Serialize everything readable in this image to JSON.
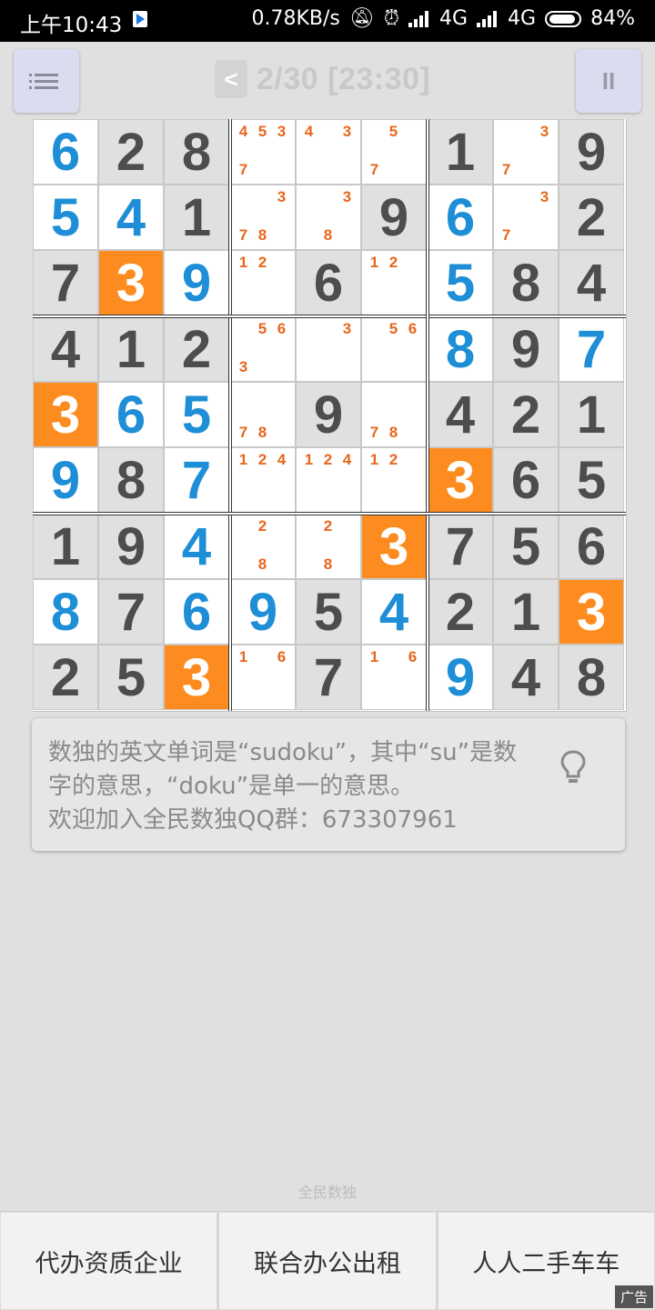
{
  "status_bar": {
    "time": "上午10:43",
    "network_speed": "0.78KB/s",
    "network_1": "4G",
    "network_2": "4G",
    "battery": "84%",
    "icons": [
      "play-store-icon",
      "mute-icon",
      "alarm-icon",
      "signal-icon",
      "hd-icon",
      "signal-icon",
      "battery-icon"
    ]
  },
  "header": {
    "back_label": "<",
    "title": "2/30 [23:30]",
    "menu_icon": "list-icon",
    "pause_label": "II"
  },
  "colors": {
    "given": "#4d4d4d",
    "user": "#1e8ed6",
    "highlight": "#fd8c20",
    "note": "#e8671b"
  },
  "board": {
    "rows": [
      [
        {
          "v": "6",
          "t": "user"
        },
        {
          "v": "2",
          "t": "given"
        },
        {
          "v": "8",
          "t": "given"
        },
        {
          "n": [
            "4",
            "5",
            "3",
            "7",
            "",
            ""
          ],
          "t": "notes"
        },
        {
          "n": [
            "4",
            "",
            "3",
            "",
            "",
            ""
          ],
          "t": "notes"
        },
        {
          "n": [
            "",
            "5",
            "",
            "7",
            "",
            ""
          ],
          "t": "notes"
        },
        {
          "v": "1",
          "t": "given"
        },
        {
          "n": [
            "",
            "",
            "3",
            "7",
            "",
            ""
          ],
          "t": "notes"
        },
        {
          "v": "9",
          "t": "given"
        }
      ],
      [
        {
          "v": "5",
          "t": "user"
        },
        {
          "v": "4",
          "t": "user"
        },
        {
          "v": "1",
          "t": "given"
        },
        {
          "n": [
            "",
            "",
            "3",
            "7",
            "8",
            ""
          ],
          "t": "notes"
        },
        {
          "n": [
            "",
            "",
            "3",
            "",
            "8",
            ""
          ],
          "t": "notes"
        },
        {
          "v": "9",
          "t": "given"
        },
        {
          "v": "6",
          "t": "user"
        },
        {
          "n": [
            "",
            "",
            "3",
            "7",
            "",
            ""
          ],
          "t": "notes"
        },
        {
          "v": "2",
          "t": "given"
        }
      ],
      [
        {
          "v": "7",
          "t": "given"
        },
        {
          "v": "3",
          "t": "hl"
        },
        {
          "v": "9",
          "t": "user"
        },
        {
          "n": [
            "1",
            "2",
            "",
            "",
            "",
            ""
          ],
          "t": "notes"
        },
        {
          "v": "6",
          "t": "given"
        },
        {
          "n": [
            "1",
            "2",
            "",
            "",
            "",
            ""
          ],
          "t": "notes"
        },
        {
          "v": "5",
          "t": "user"
        },
        {
          "v": "8",
          "t": "given"
        },
        {
          "v": "4",
          "t": "given"
        }
      ],
      [
        {
          "v": "4",
          "t": "given"
        },
        {
          "v": "1",
          "t": "given"
        },
        {
          "v": "2",
          "t": "given"
        },
        {
          "n": [
            "",
            "5",
            "6",
            "3",
            "",
            ""
          ],
          "t": "notes"
        },
        {
          "n": [
            "",
            "",
            "3",
            "",
            "",
            ""
          ],
          "t": "notes"
        },
        {
          "n": [
            "",
            "5",
            "6",
            "",
            "",
            ""
          ],
          "t": "notes"
        },
        {
          "v": "8",
          "t": "user"
        },
        {
          "v": "9",
          "t": "given"
        },
        {
          "v": "7",
          "t": "user"
        }
      ],
      [
        {
          "v": "3",
          "t": "hl"
        },
        {
          "v": "6",
          "t": "user"
        },
        {
          "v": "5",
          "t": "user"
        },
        {
          "n": [
            "",
            "",
            "",
            "7",
            "8",
            ""
          ],
          "t": "notes"
        },
        {
          "v": "9",
          "t": "given"
        },
        {
          "n": [
            "",
            "",
            "",
            "7",
            "8",
            ""
          ],
          "t": "notes"
        },
        {
          "v": "4",
          "t": "given"
        },
        {
          "v": "2",
          "t": "given"
        },
        {
          "v": "1",
          "t": "given"
        }
      ],
      [
        {
          "v": "9",
          "t": "user"
        },
        {
          "v": "8",
          "t": "given"
        },
        {
          "v": "7",
          "t": "user"
        },
        {
          "n": [
            "1",
            "2",
            "4",
            "",
            "",
            ""
          ],
          "t": "notes"
        },
        {
          "n": [
            "1",
            "2",
            "4",
            "",
            "",
            ""
          ],
          "t": "notes"
        },
        {
          "n": [
            "1",
            "2",
            "",
            "",
            "",
            ""
          ],
          "t": "notes"
        },
        {
          "v": "3",
          "t": "hl"
        },
        {
          "v": "6",
          "t": "given"
        },
        {
          "v": "5",
          "t": "given"
        }
      ],
      [
        {
          "v": "1",
          "t": "given"
        },
        {
          "v": "9",
          "t": "given"
        },
        {
          "v": "4",
          "t": "user"
        },
        {
          "n": [
            "",
            "2",
            "",
            "",
            "8",
            ""
          ],
          "t": "notes"
        },
        {
          "n": [
            "",
            "2",
            "",
            "",
            "8",
            ""
          ],
          "t": "notes"
        },
        {
          "v": "3",
          "t": "hl"
        },
        {
          "v": "7",
          "t": "given"
        },
        {
          "v": "5",
          "t": "given"
        },
        {
          "v": "6",
          "t": "given"
        }
      ],
      [
        {
          "v": "8",
          "t": "user"
        },
        {
          "v": "7",
          "t": "given"
        },
        {
          "v": "6",
          "t": "user"
        },
        {
          "v": "9",
          "t": "user"
        },
        {
          "v": "5",
          "t": "given"
        },
        {
          "v": "4",
          "t": "user"
        },
        {
          "v": "2",
          "t": "given"
        },
        {
          "v": "1",
          "t": "given"
        },
        {
          "v": "3",
          "t": "hl"
        }
      ],
      [
        {
          "v": "2",
          "t": "given"
        },
        {
          "v": "5",
          "t": "given"
        },
        {
          "v": "3",
          "t": "hl"
        },
        {
          "n": [
            "1",
            "",
            "6",
            "",
            "",
            ""
          ],
          "t": "notes"
        },
        {
          "v": "7",
          "t": "given"
        },
        {
          "n": [
            "1",
            "",
            "6",
            "",
            "",
            ""
          ],
          "t": "notes"
        },
        {
          "v": "9",
          "t": "user"
        },
        {
          "v": "4",
          "t": "given"
        },
        {
          "v": "8",
          "t": "given"
        }
      ]
    ]
  },
  "tip": {
    "line1": "数独的英文单词是“sudoku”，其中“su”是数",
    "line2": "字的意思，“doku”是单一的意思。",
    "line3": "欢迎加入全民数独QQ群：673307961",
    "icon": "lightbulb-icon"
  },
  "footer": {
    "app_label": "全民数独",
    "ads": [
      "代办资质企业",
      "联合办公出租",
      "人人二手车车"
    ],
    "ad_badge": "广告"
  }
}
